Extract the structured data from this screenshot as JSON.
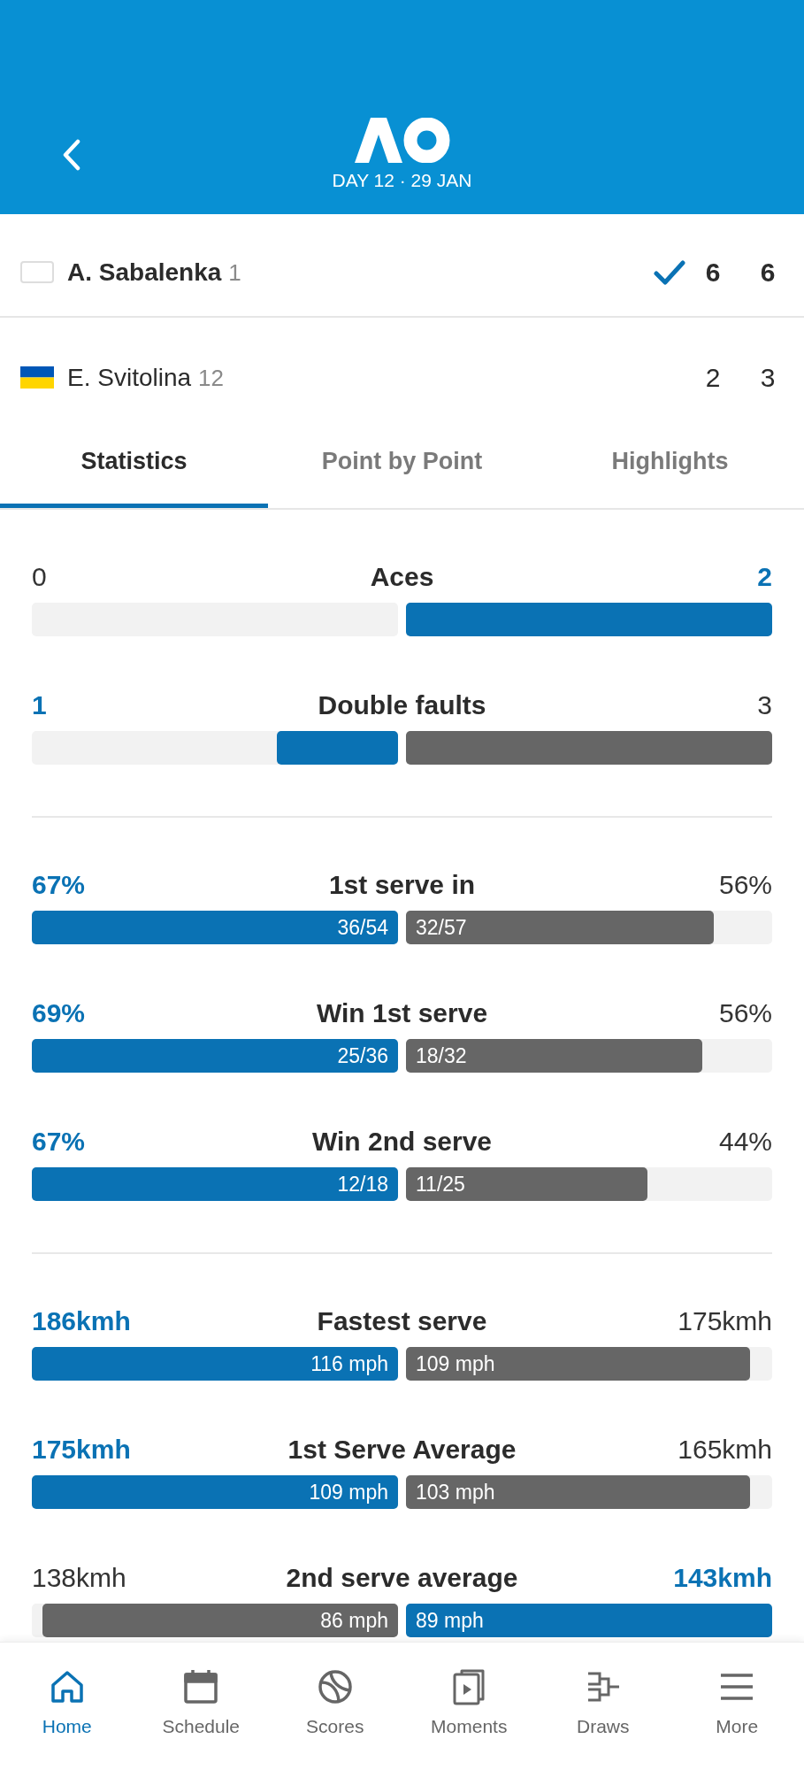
{
  "header": {
    "date": "DAY 12 · 29 JAN"
  },
  "players": [
    {
      "name": "A. Sabalenka",
      "seed": "1",
      "flag": {
        "kind": "blank"
      },
      "winner": true,
      "scores": [
        "6",
        "6"
      ]
    },
    {
      "name": "E. Svitolina",
      "seed": "12",
      "flag": {
        "kind": "ukraine"
      },
      "winner": false,
      "scores": [
        "2",
        "3"
      ]
    }
  ],
  "tabs": [
    {
      "label": "Statistics",
      "selected": true
    },
    {
      "label": "Point by Point",
      "selected": false
    },
    {
      "label": "Highlights",
      "selected": false
    }
  ],
  "stat_groups": [
    {
      "stats": [
        {
          "label": "Aces",
          "left": {
            "value": "0",
            "leading": false
          },
          "right": {
            "value": "2",
            "leading": true,
            "level": 1
          }
        },
        {
          "label": "Double faults",
          "left": {
            "value": "1",
            "leading": true,
            "level": 0.33
          },
          "right": {
            "value": "3",
            "leading": false,
            "level": 1
          }
        }
      ]
    },
    {
      "stats": [
        {
          "label": "1st serve in",
          "left": {
            "value": "67%",
            "leading": true,
            "level": 1,
            "bar_text": "36/54"
          },
          "right": {
            "value": "56%",
            "leading": false,
            "level": 0.84,
            "bar_text": "32/57"
          }
        },
        {
          "label": "Win 1st serve",
          "left": {
            "value": "69%",
            "leading": true,
            "level": 1,
            "bar_text": "25/36"
          },
          "right": {
            "value": "56%",
            "leading": false,
            "level": 0.81,
            "bar_text": "18/32"
          }
        },
        {
          "label": "Win 2nd serve",
          "left": {
            "value": "67%",
            "leading": true,
            "level": 1,
            "bar_text": "12/18"
          },
          "right": {
            "value": "44%",
            "leading": false,
            "level": 0.66,
            "bar_text": "11/25"
          }
        }
      ]
    },
    {
      "stats": [
        {
          "label": "Fastest serve",
          "left": {
            "value": "186kmh",
            "leading": true,
            "level": 1,
            "bar_text": "116 mph"
          },
          "right": {
            "value": "175kmh",
            "leading": false,
            "level": 0.94,
            "bar_text": "109 mph"
          }
        },
        {
          "label": "1st Serve Average",
          "left": {
            "value": "175kmh",
            "leading": true,
            "level": 1,
            "bar_text": "109 mph"
          },
          "right": {
            "value": "165kmh",
            "leading": false,
            "level": 0.94,
            "bar_text": "103 mph"
          }
        },
        {
          "label": "2nd serve average",
          "left": {
            "value": "138kmh",
            "leading": false,
            "level": 0.97,
            "bar_text": "86 mph"
          },
          "right": {
            "value": "143kmh",
            "leading": true,
            "level": 1,
            "bar_text": "89 mph"
          }
        }
      ]
    }
  ],
  "bottom_nav": [
    {
      "label": "Home",
      "selected": true
    },
    {
      "label": "Schedule",
      "selected": false
    },
    {
      "label": "Scores",
      "selected": false
    },
    {
      "label": "Moments",
      "selected": false
    },
    {
      "label": "Draws",
      "selected": false
    },
    {
      "label": "More",
      "selected": false
    }
  ]
}
